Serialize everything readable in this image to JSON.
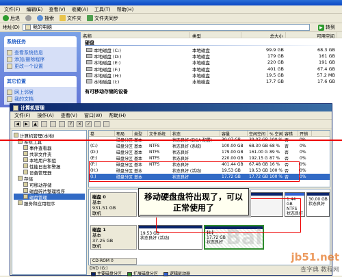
{
  "explorer": {
    "menu": [
      "文件(F)",
      "编辑(E)",
      "查看(V)",
      "收藏(A)",
      "工具(T)",
      "帮助(H)"
    ],
    "toolbar": {
      "back": "后退",
      "search": "搜索",
      "folders": "文件夹",
      "sync": "文件夹同步"
    },
    "address_label": "地址(D)",
    "address_value": "我的电脑",
    "go_label": "转到",
    "system_tasks": {
      "title": "系统任务",
      "items": [
        "查看系统信息",
        "添加/删除程序",
        "更改一个设置"
      ]
    },
    "other_places": {
      "title": "其它位置",
      "items": [
        "网上邻居",
        "我的文档"
      ]
    },
    "columns": [
      "名称",
      "类型",
      "总大小",
      "可用空间"
    ],
    "group_hdd": "硬盘",
    "drives": [
      {
        "name": "本地磁盘 (C:)",
        "type": "本地磁盘",
        "total": "99.9 GB",
        "free": "68.3 GB"
      },
      {
        "name": "本地磁盘 (D:)",
        "type": "本地磁盘",
        "total": "179 GB",
        "free": "161 GB"
      },
      {
        "name": "本地磁盘 (E:)",
        "type": "本地磁盘",
        "total": "220 GB",
        "free": "191 GB"
      },
      {
        "name": "本地磁盘 (F:)",
        "type": "本地磁盘",
        "total": "401 GB",
        "free": "67.4 GB"
      },
      {
        "name": "本地磁盘 (H:)",
        "type": "本地磁盘",
        "total": "19.5 GB",
        "free": "57.2 MB"
      },
      {
        "name": "本地磁盘 (I:)",
        "type": "本地磁盘",
        "total": "17.7 GB",
        "free": "17.6 GB"
      }
    ],
    "group_removable": "有可移动存储的设备"
  },
  "cm": {
    "title": "计算机管理",
    "menu": [
      "文件(F)",
      "操作(A)",
      "查看(V)",
      "窗口(W)",
      "帮助(H)"
    ],
    "tree": [
      "计算机管理(本地)",
      "系统工具",
      "事件查看器",
      "共享文件夹",
      "本地用户和组",
      "性能日志和警报",
      "设备管理器",
      "存储",
      "可移动存储",
      "磁盘碎片整理程序",
      "磁盘管理",
      "服务和应用程序"
    ],
    "vol_columns": [
      "卷",
      "布局",
      "类型",
      "文件系统",
      "状态",
      "容量",
      "空闲空间",
      "% 空闲",
      "容错",
      "开销"
    ],
    "volumes": [
      {
        "vol": "",
        "layout": "磁盘分区",
        "type": "基本",
        "fs": "",
        "status": "状态良好 (EISA 配置)",
        "cap": "39.07 GB",
        "free": "39.07 GB",
        "pct": "100 %",
        "ft": "否",
        "ov": "0%"
      },
      {
        "vol": "(C:)",
        "layout": "磁盘分区",
        "type": "基本",
        "fs": "NTFS",
        "status": "状态良好 (系统)",
        "cap": "100.00 GB",
        "free": "68.30 GB",
        "pct": "68 %",
        "ft": "否",
        "ov": "0%"
      },
      {
        "vol": "(D:)",
        "layout": "磁盘分区",
        "type": "基本",
        "fs": "NTFS",
        "status": "状态良好",
        "cap": "179.00 GB",
        "free": "161.00 GB",
        "pct": "89 %",
        "ft": "否",
        "ov": "0%"
      },
      {
        "vol": "(E:)",
        "layout": "磁盘分区",
        "type": "基本",
        "fs": "NTFS",
        "status": "状态良好",
        "cap": "220.00 GB",
        "free": "192.15 GB",
        "pct": "87 %",
        "ft": "否",
        "ov": "0%"
      },
      {
        "vol": "(F:)",
        "layout": "磁盘分区",
        "type": "基本",
        "fs": "NTFS",
        "status": "状态良好",
        "cap": "401.44 GB",
        "free": "67.48 GB",
        "pct": "16 %",
        "ft": "否",
        "ov": "0%"
      },
      {
        "vol": "(H:)",
        "layout": "磁盘分区",
        "type": "基本",
        "fs": "",
        "status": "状态良好 (活动)",
        "cap": "19.53 GB",
        "free": "19.53 GB",
        "pct": "100 %",
        "ft": "否",
        "ov": "0%"
      },
      {
        "vol": "(I:)",
        "layout": "磁盘分区",
        "type": "基本",
        "fs": "",
        "status": "状态良好",
        "cap": "17.72 GB",
        "free": "17.72 GB",
        "pct": "100 %",
        "ft": "否",
        "ov": "0%"
      }
    ],
    "disk0": {
      "name": "磁盘 0",
      "kind": "基本",
      "size": "931.51 GB",
      "state": "联机"
    },
    "disk0_part": {
      "size": "1.44 GB",
      "fs": "NTFS",
      "status": "状态良好"
    },
    "disk0_last": {
      "label": "30.00 GB",
      "status": "状态良好"
    },
    "disk1": {
      "name": "磁盘 1",
      "kind": "基本",
      "size": "37.25 GB",
      "state": "联机"
    },
    "disk1_p1": {
      "size": "19.53 GB",
      "status": "状态良好 (活动)"
    },
    "disk1_p2": {
      "vol": "(I:)",
      "size": "17.72 GB",
      "status": "状态良好"
    },
    "cdrom": "CD-ROM 0",
    "cdrom_sub": "DVD (G:)",
    "legend": [
      "主要磁盘分区",
      "扩展磁盘分区",
      "逻辑驱动器"
    ],
    "legend_colors": [
      "#0a246a",
      "#2e8b2e",
      "#3060d0"
    ]
  },
  "annotation": "移动硬盘盘符出现了，可以正常使用了",
  "watermarks": {
    "a": "jb51.net",
    "b": "查字典 教程网",
    "c": "Bai"
  }
}
